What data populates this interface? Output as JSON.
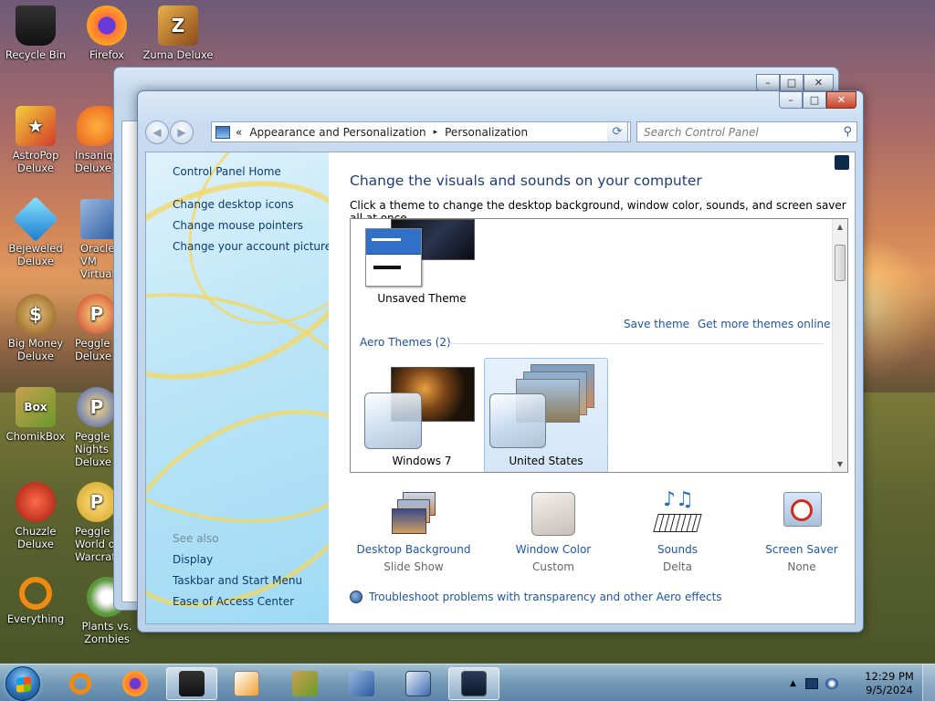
{
  "desktop": {
    "icons": [
      {
        "label": "Recycle Bin",
        "color": "#1e1e22"
      },
      {
        "label": "Firefox",
        "color": "#ff7139"
      },
      {
        "label": "Zuma Deluxe",
        "color": "#c27a2a"
      },
      {
        "label": "AstroPop Deluxe",
        "color": "#d23a2a"
      },
      {
        "label": "Insaniquarium Deluxe",
        "color": "#e8781a"
      },
      {
        "label": "Bejeweled Deluxe",
        "color": "#2aa0e0"
      },
      {
        "label": "Oracle VM VirtualBox",
        "color": "#2a5aa0"
      },
      {
        "label": "Big Money Deluxe",
        "color": "#b8863a"
      },
      {
        "label": "Peggle Deluxe",
        "color": "#c8342a"
      },
      {
        "label": "ChomikBox",
        "color": "#6a9a2a"
      },
      {
        "label": "Peggle Nights Deluxe",
        "color": "#3a5ac8"
      },
      {
        "label": "Chuzzle Deluxe",
        "color": "#d02a1a"
      },
      {
        "label": "Peggle World of Warcraft",
        "color": "#d0a020"
      },
      {
        "label": "Everything",
        "color": "#f08a10"
      },
      {
        "label": "Plants vs. Zombies",
        "color": "#5a9a3a"
      }
    ]
  },
  "window": {
    "address": {
      "overflow": "«",
      "segment1": "Appearance and Personalization",
      "segment2": "Personalization",
      "arrow": "▸",
      "dropdown": "▾"
    },
    "refresh_glyph": "⟳",
    "search_placeholder": "Search Control Panel",
    "search_glyph": "⚲",
    "captions": {
      "minimize": "–",
      "maximize": "□",
      "close": "✕"
    },
    "nav": {
      "back": "◀",
      "forward": "▶"
    },
    "left_pane": {
      "home": "Control Panel Home",
      "links": [
        "Change desktop icons",
        "Change mouse pointers",
        "Change your account picture"
      ],
      "see_also": "See also",
      "see_also_links": [
        "Display",
        "Taskbar and Start Menu",
        "Ease of Access Center"
      ]
    },
    "main": {
      "title": "Change the visuals and sounds on your computer",
      "subtitle": "Click a theme to change the desktop background, window color, sounds, and screen saver all at once.",
      "unsaved_theme": "Unsaved Theme",
      "save_theme": "Save theme",
      "get_more": "Get more themes online",
      "group_header": "Aero Themes (2)",
      "themes": [
        "Windows 7",
        "United States"
      ],
      "scroll_up": "▲",
      "scroll_down": "▼",
      "options": [
        {
          "label": "Desktop Background",
          "value": "Slide Show"
        },
        {
          "label": "Window Color",
          "value": "Custom"
        },
        {
          "label": "Sounds",
          "value": "Delta"
        },
        {
          "label": "Screen Saver",
          "value": "None"
        }
      ],
      "troubleshoot": "Troubleshoot problems with transparency and other Aero effects"
    }
  },
  "taskbar": {
    "tray_arrow": "▲",
    "time": "12:29 PM",
    "date": "9/5/2024"
  }
}
